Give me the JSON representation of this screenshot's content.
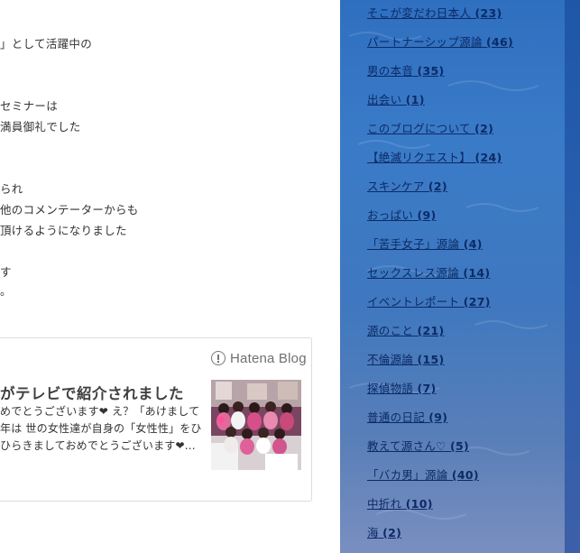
{
  "main": {
    "lines": [
      "」として活躍中の",
      "セミナーは",
      "満員御礼でした",
      "られ",
      "他のコメンテーターからも",
      "頂けるようになりました",
      "す",
      "。"
    ],
    "embed_card": {
      "brand": "Hatena Blog",
      "title": "がテレビで紹介されました",
      "desc": [
        "めでとうございます❤ え？「あけまして",
        "年は 世の女性達が自身の「女性性」をひ",
        "ひらきましておめでとうございます❤..."
      ]
    }
  },
  "sidebar": {
    "categories": [
      {
        "name": "そこが変だわ日本人",
        "count": "(23)"
      },
      {
        "name": "パートナーシップ源論",
        "count": "(46)"
      },
      {
        "name": "男の本音",
        "count": "(35)"
      },
      {
        "name": "出会い",
        "count": "(1)"
      },
      {
        "name": "このブログについて",
        "count": "(2)"
      },
      {
        "name": "【絶滅リクエスト】",
        "count": "(24)"
      },
      {
        "name": "スキンケア",
        "count": "(2)"
      },
      {
        "name": "おっぱい",
        "count": "(9)"
      },
      {
        "name": "「苦手女子」源論",
        "count": "(4)"
      },
      {
        "name": "セックスレス源論",
        "count": "(14)"
      },
      {
        "name": "イベントレポート",
        "count": "(27)"
      },
      {
        "name": "源のこと",
        "count": "(21)"
      },
      {
        "name": "不倫源論",
        "count": "(15)"
      },
      {
        "name": "探偵物語",
        "count": "(7)"
      },
      {
        "name": "普通の日記",
        "count": "(9)"
      },
      {
        "name": "教えて源さん♡",
        "count": "(5)"
      },
      {
        "name": "「バカ男」源論",
        "count": "(40)"
      },
      {
        "name": "中折れ",
        "count": "(10)"
      },
      {
        "name": "海",
        "count": "(2)"
      }
    ]
  }
}
